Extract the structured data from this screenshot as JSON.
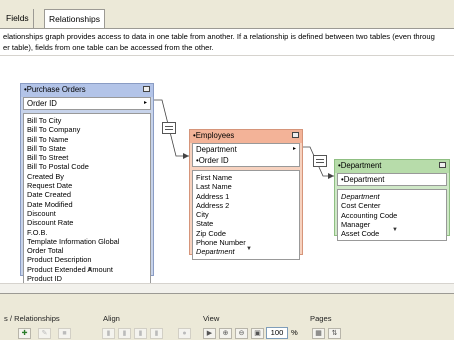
{
  "tabs": {
    "fields": "Fields",
    "relationships": "Relationships"
  },
  "description": {
    "line1": "elationships graph provides access to data in one table from another. If a relationship is defined between two tables (even throug",
    "line2": "er table), fields from one table can be accessed from the other."
  },
  "tables": {
    "purchase_orders": {
      "title": "•Purchase Orders",
      "keys": [
        "Order ID"
      ],
      "fields": [
        "Bill To City",
        "Bill To Company",
        "Bill To Name",
        "Bill To State",
        "Bill To Street",
        "Bill To Postal Code",
        "Created By",
        "Request Date",
        "Date Created",
        "Date Modified",
        "Discount",
        "Discount Rate",
        "F.O.B.",
        "Template Information Global",
        "Order Total",
        "Product Description",
        "Product Extended Amount",
        "Product ID"
      ]
    },
    "employees": {
      "title": "•Employees",
      "keys": [
        "Department",
        "•Order ID"
      ],
      "fields": [
        "First Name",
        "Last Name",
        "Address 1",
        "Address 2",
        "City",
        "State",
        "Zip Code",
        "Phone Number",
        "Department"
      ]
    },
    "department": {
      "title": "•Department",
      "keys": [
        "•Department"
      ],
      "fields": [
        "Department",
        "Cost Center",
        "Accounting Code",
        "Manager",
        "Asset Code"
      ]
    }
  },
  "toolbar": {
    "sections": {
      "tables_relationships": "s / Relationships",
      "align": "Align",
      "view": "View",
      "pages": "Pages"
    },
    "zoom_value": "100",
    "zoom_unit": "%"
  }
}
